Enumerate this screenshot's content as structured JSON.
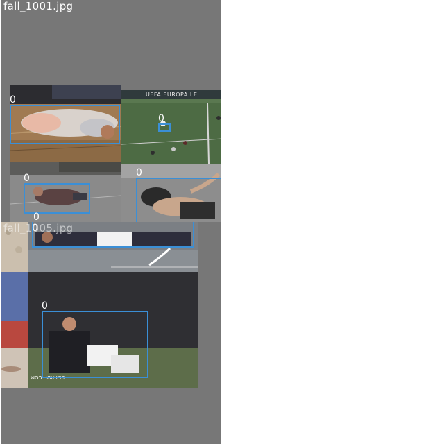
{
  "mosaic": {
    "tiles": [
      {
        "filename": "fall_1001.jpg",
        "photos": [
          {
            "name": "gym-floor-fall",
            "detections": [
              {
                "label": "0"
              }
            ]
          },
          {
            "name": "soccer-pitch-fall",
            "banner": "UEFA EUROPA LE",
            "detections": [
              {
                "label": "0"
              }
            ]
          },
          {
            "name": "street-fall",
            "detections": [
              {
                "label": "0"
              },
              {
                "label": "0"
              }
            ]
          },
          {
            "name": "court-fall",
            "detections": [
              {
                "label": "0"
              }
            ]
          }
        ]
      },
      {
        "filename": "fall_1005.jpg",
        "photos": [
          {
            "name": "track-fall",
            "detections": [
              {
                "label": "0"
              }
            ]
          },
          {
            "name": "goalkeeper-sitting",
            "jersey_text": "BET.ROH.COM",
            "detections": [
              {
                "label": "0"
              }
            ]
          }
        ]
      }
    ]
  }
}
